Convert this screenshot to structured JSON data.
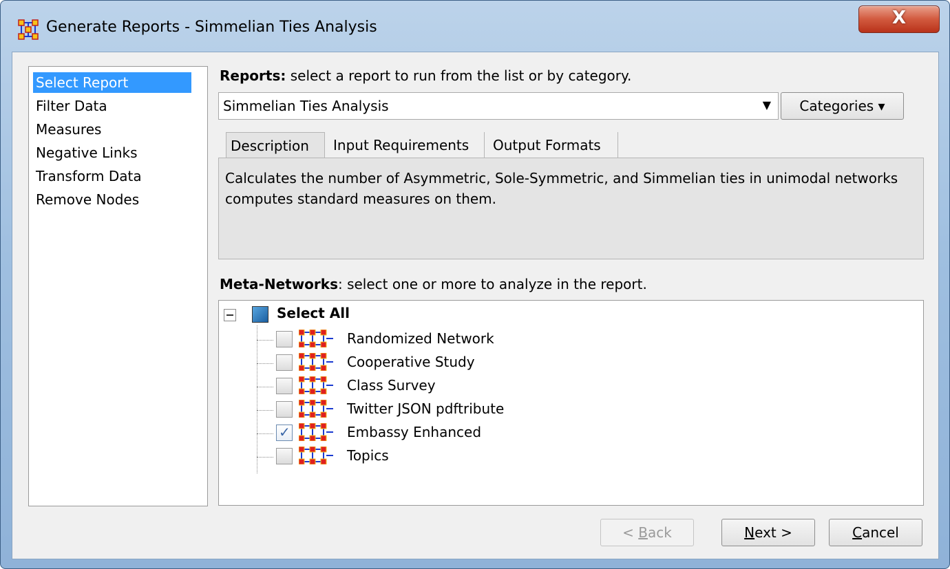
{
  "window": {
    "title": "Generate Reports - Simmelian Ties Analysis",
    "close_label": "X"
  },
  "nav": {
    "items": [
      {
        "label": "Select Report",
        "selected": true
      },
      {
        "label": "Filter Data",
        "selected": false
      },
      {
        "label": "Measures",
        "selected": false
      },
      {
        "label": "Negative Links",
        "selected": false
      },
      {
        "label": "Transform Data",
        "selected": false
      },
      {
        "label": "Remove Nodes",
        "selected": false
      }
    ]
  },
  "reports": {
    "heading_bold": "Reports:",
    "heading_rest": " select a report to run from the list or by category.",
    "selected_value": "Simmelian Ties Analysis",
    "categories_label": "Categories ▾"
  },
  "tabs": [
    {
      "label": "Description",
      "active": true
    },
    {
      "label": "Input Requirements",
      "active": false
    },
    {
      "label": "Output Formats",
      "active": false
    }
  ],
  "description": "Calculates the number of Asymmetric, Sole-Symmetric, and Simmelian ties in unimodal networks computes standard measures on them.",
  "meta_networks": {
    "heading_bold": "Meta-Networks",
    "heading_rest": ": select one or more to analyze in the report.",
    "select_all_label": "Select All",
    "items": [
      {
        "label": "Randomized Network",
        "checked": false
      },
      {
        "label": "Cooperative Study",
        "checked": false
      },
      {
        "label": "Class Survey",
        "checked": false
      },
      {
        "label": "Twitter JSON pdftribute",
        "checked": false
      },
      {
        "label": "Embassy Enhanced",
        "checked": true
      },
      {
        "label": "Topics",
        "checked": false
      }
    ]
  },
  "buttons": {
    "back_prefix": "< ",
    "back_mnemonic": "B",
    "back_rest": "ack",
    "next_mnemonic": "N",
    "next_rest": "ext >",
    "cancel_mnemonic": "C",
    "cancel_rest": "ancel"
  },
  "colors": {
    "selection": "#3399ff",
    "titlebar": "#9fbfe0",
    "close_button": "#c8452a",
    "network_icon_node": "#e02020",
    "network_icon_link": "#1a3ad0"
  },
  "icons": {
    "app": "meta-network-app-icon",
    "network": "meta-network-icon",
    "expander": "tree-collapse-icon",
    "dropdown": "dropdown-arrow-icon"
  }
}
